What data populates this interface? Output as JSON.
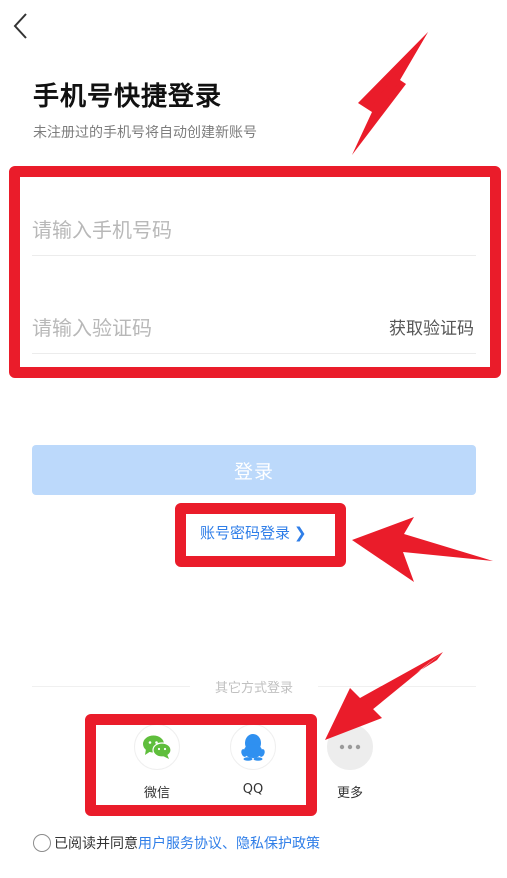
{
  "header": {
    "back_icon": "chevron-left-icon"
  },
  "title": "手机号快捷登录",
  "subtitle": "未注册过的手机号将自动创建新账号",
  "form": {
    "phone_placeholder": "请输入手机号码",
    "phone_value": "",
    "code_placeholder": "请输入验证码",
    "code_value": "",
    "get_code_label": "获取验证码"
  },
  "login_button_label": "登录",
  "password_login_label": "账号密码登录",
  "other_login": {
    "label": "其它方式登录",
    "options": [
      {
        "label": "微信",
        "icon": "wechat-icon"
      },
      {
        "label": "QQ",
        "icon": "qq-icon"
      },
      {
        "label": "更多",
        "icon": "more-icon"
      }
    ]
  },
  "agreement": {
    "prefix": "已阅读并同意",
    "link": "用户服务协议、隐私保护政策",
    "checked": false
  },
  "colors": {
    "accent": "#2f7ee8",
    "login_button_bg": "#bcd9fb",
    "annotation_red": "#ea1c2a",
    "wechat_green": "#5fbe3c",
    "qq_blue": "#2f90f0"
  }
}
